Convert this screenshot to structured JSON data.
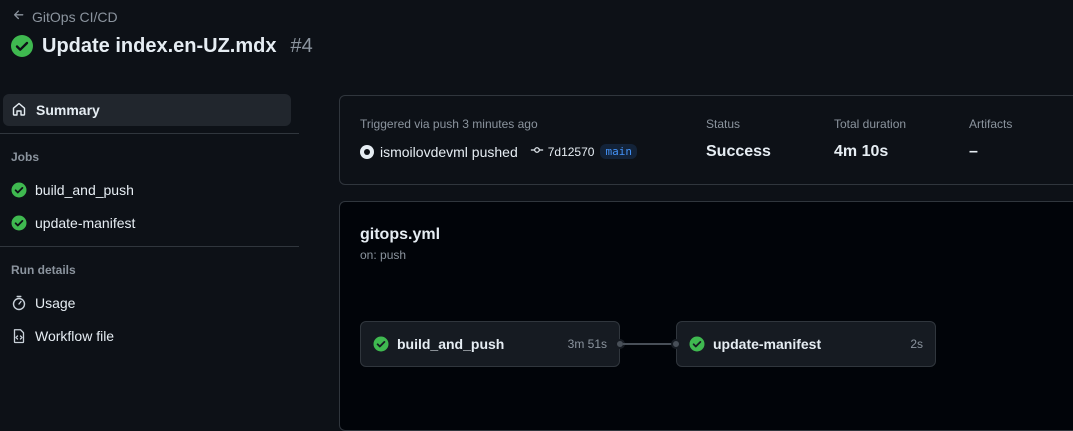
{
  "header": {
    "back_label": "GitOps CI/CD",
    "run_title": "Update index.en-UZ.mdx",
    "run_number": "#4"
  },
  "sidebar": {
    "summary_label": "Summary",
    "jobs_heading": "Jobs",
    "jobs": [
      {
        "label": "build_and_push",
        "status": "success"
      },
      {
        "label": "update-manifest",
        "status": "success"
      }
    ],
    "run_details_heading": "Run details",
    "details": [
      {
        "label": "Usage",
        "icon": "stopwatch-icon"
      },
      {
        "label": "Workflow file",
        "icon": "file-code-icon"
      }
    ]
  },
  "summary": {
    "trigger_text": "Triggered via push 3 minutes ago",
    "actor": "ismoilovdevml pushed",
    "commit": "7d12570",
    "branch": "main",
    "status_label": "Status",
    "status_value": "Success",
    "duration_label": "Total duration",
    "duration_value": "4m 10s",
    "artifacts_label": "Artifacts",
    "artifacts_value": "–"
  },
  "workflow": {
    "file": "gitops.yml",
    "trigger": "on: push",
    "jobs": [
      {
        "label": "build_and_push",
        "time": "3m 51s"
      },
      {
        "label": "update-manifest",
        "time": "2s"
      }
    ]
  },
  "colors": {
    "background": "#0d1117",
    "success": "#3fb950",
    "accent": "#4493f8",
    "muted": "#8b949e"
  }
}
